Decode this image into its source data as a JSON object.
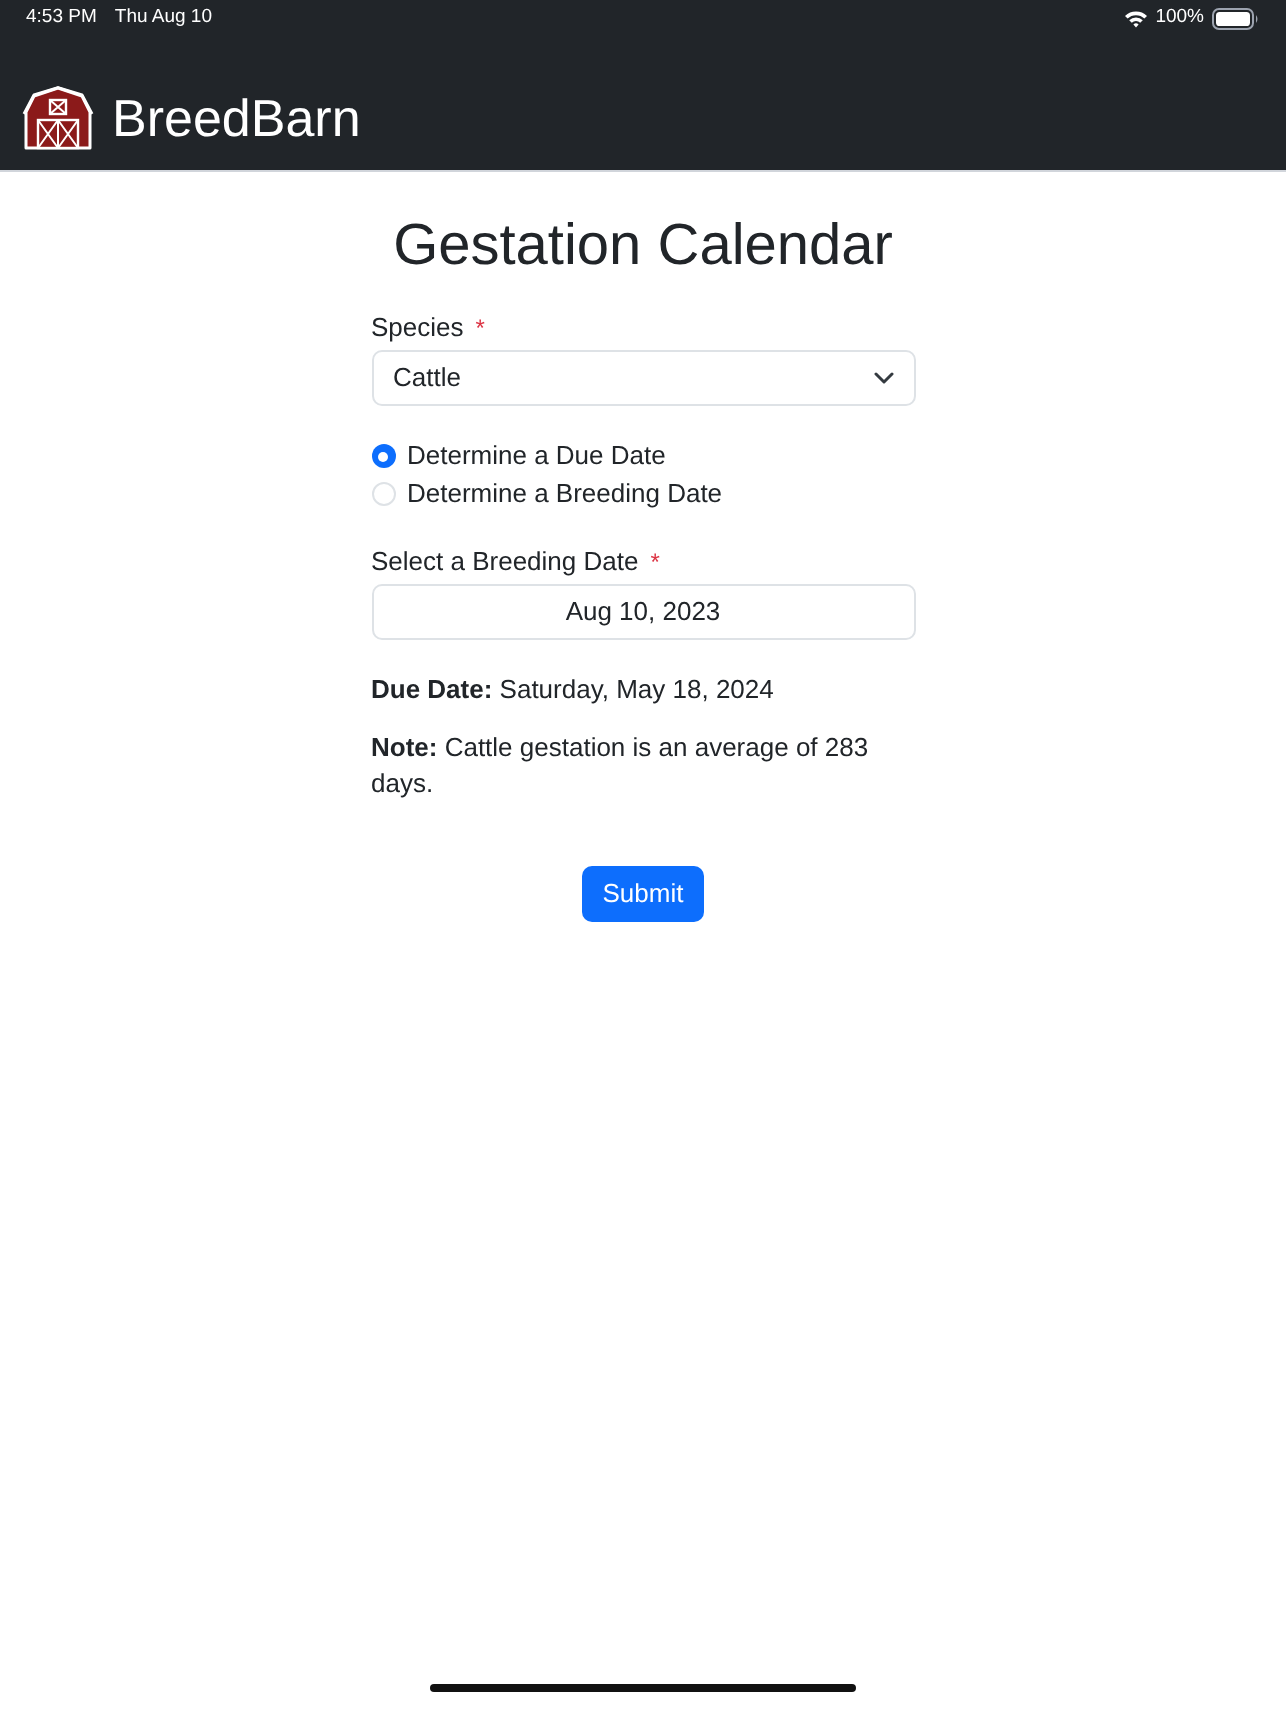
{
  "status_bar": {
    "time": "4:53 PM",
    "date": "Thu Aug 10",
    "battery": "100%"
  },
  "header": {
    "brand": "BreedBarn"
  },
  "title": "Gestation Calendar",
  "species": {
    "label": "Species",
    "required_mark": "*",
    "value": "Cattle"
  },
  "modes": [
    {
      "label": "Determine a Due Date",
      "selected": true
    },
    {
      "label": "Determine a Breeding Date",
      "selected": false
    }
  ],
  "breeding_date": {
    "label": "Select a Breeding Date",
    "required_mark": "*",
    "value": "Aug 10, 2023"
  },
  "result": "**Due Date:** Saturday, May 18, 2024",
  "note": "**Note:** Cattle gestation is an average of 283 days.",
  "submit": "Submit"
}
